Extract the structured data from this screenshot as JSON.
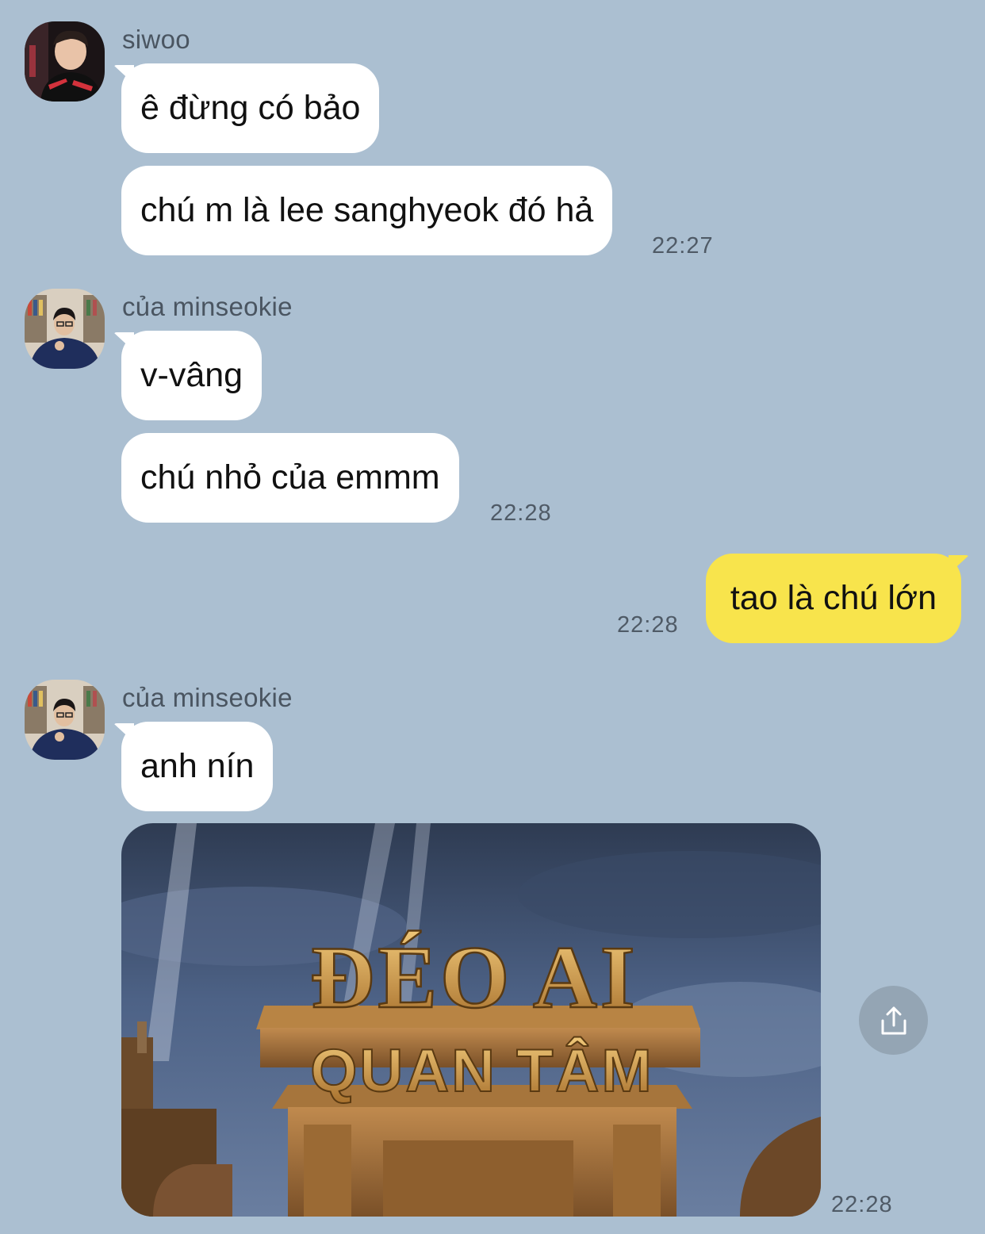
{
  "messages": [
    {
      "sender": "siwoo",
      "bubbles": [
        "ê đừng có bảo",
        "chú m là lee sanghyeok đó hả"
      ],
      "time": "22:27"
    },
    {
      "sender": "của minseokie",
      "bubbles": [
        "v-vâng",
        "chú nhỏ của emmm"
      ],
      "time": "22:28"
    },
    {
      "mine": true,
      "bubbles": [
        "tao là chú lớn"
      ],
      "time": "22:28"
    },
    {
      "sender": "của minseokie",
      "bubbles": [
        "anh nín"
      ],
      "image": {
        "top_text": "ĐÉO AI",
        "bottom_text": "QUAN TÂM"
      },
      "time": "22:28"
    }
  ],
  "icons": {
    "share": "share-icon"
  },
  "colors": {
    "background": "#abbfd1",
    "my_bubble": "#f8e44c",
    "their_bubble": "#ffffff"
  }
}
